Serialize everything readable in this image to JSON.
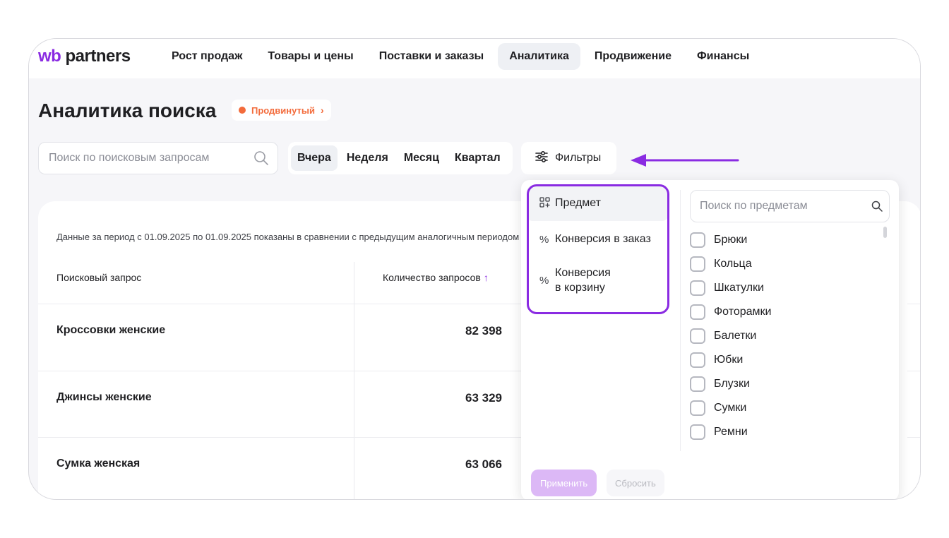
{
  "logo": {
    "wb": "wb",
    "partners": "partners"
  },
  "nav": {
    "items": [
      {
        "label": "Рост продаж"
      },
      {
        "label": "Товары и цены"
      },
      {
        "label": "Поставки и заказы"
      },
      {
        "label": "Аналитика",
        "active": true
      },
      {
        "label": "Продвижение"
      },
      {
        "label": "Финансы"
      }
    ]
  },
  "header": {
    "title": "Аналитика поиска",
    "badge": "Продвинутый"
  },
  "search": {
    "placeholder": "Поиск по поисковым запросам"
  },
  "periods": [
    {
      "label": "Вчера",
      "active": true
    },
    {
      "label": "Неделя"
    },
    {
      "label": "Месяц"
    },
    {
      "label": "Квартал"
    }
  ],
  "filters": {
    "label": "Фильтры"
  },
  "table": {
    "note": "Данные за период с 01.09.2025 по 01.09.2025 показаны в сравнении с предыдущим аналогичным периодом",
    "headers": {
      "query": "Поисковый запрос",
      "count": "Количество запросов"
    },
    "rows": [
      {
        "query": "Кроссовки женские",
        "count": "82 398"
      },
      {
        "query": "Джинсы женские",
        "count": "63 329"
      },
      {
        "query": "Сумка женская",
        "count": "63 066"
      }
    ]
  },
  "dropdown": {
    "categories": [
      {
        "label": "Предмет",
        "icon": "grid-plus-icon",
        "active": true
      },
      {
        "label": "Конверсия в заказ",
        "icon": "percent-icon"
      },
      {
        "label_line1": "Конверсия",
        "label_line2": "в корзину",
        "icon": "percent-icon"
      }
    ],
    "search_placeholder": "Поиск по предметам",
    "subjects": [
      "Брюки",
      "Кольца",
      "Шкатулки",
      "Фоторамки",
      "Балетки",
      "Юбки",
      "Блузки",
      "Сумки",
      "Ремни"
    ],
    "apply": "Применить",
    "reset": "Сбросить"
  },
  "colors": {
    "accent": "#8a2be2",
    "badge": "#f36b3b",
    "apply_disabled": "#dcb8f6"
  }
}
